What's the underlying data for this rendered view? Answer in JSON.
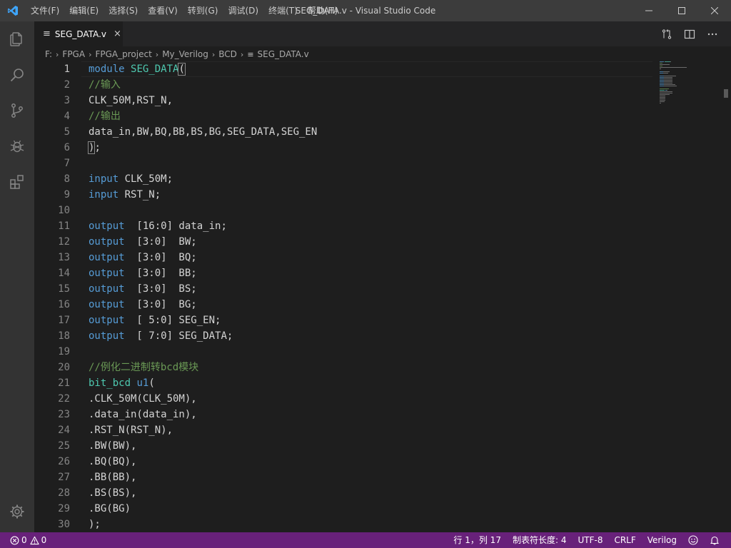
{
  "titlebar": {
    "menu": [
      "文件(F)",
      "编辑(E)",
      "选择(S)",
      "查看(V)",
      "转到(G)",
      "调试(D)",
      "终端(T)",
      "帮助(H)"
    ],
    "window_title": "SEG_DATA.v - Visual Studio Code"
  },
  "tab": {
    "label": "SEG_DATA.v",
    "close": "×"
  },
  "breadcrumb": [
    "F:",
    "FPGA",
    "FPGA_project",
    "My_Verilog",
    "BCD",
    "SEG_DATA.v"
  ],
  "code_lines": [
    {
      "n": "1",
      "parts": [
        {
          "t": "module",
          "c": "kw"
        },
        {
          "t": " "
        },
        {
          "t": "SEG_DATA",
          "c": "ident"
        },
        {
          "t": "(",
          "c": "bracket"
        }
      ]
    },
    {
      "n": "2",
      "parts": [
        {
          "t": "//输入",
          "c": "cm"
        }
      ]
    },
    {
      "n": "3",
      "parts": [
        {
          "t": "CLK_50M,RST_N,"
        }
      ]
    },
    {
      "n": "4",
      "parts": [
        {
          "t": "//输出",
          "c": "cm"
        }
      ]
    },
    {
      "n": "5",
      "parts": [
        {
          "t": "data_in,BW,BQ,BB,BS,BG,SEG_DATA,SEG_EN"
        }
      ]
    },
    {
      "n": "6",
      "parts": [
        {
          "t": ")",
          "c": "bracket"
        },
        {
          "t": ";"
        }
      ]
    },
    {
      "n": "7",
      "parts": []
    },
    {
      "n": "8",
      "parts": [
        {
          "t": "input",
          "c": "kw"
        },
        {
          "t": " CLK_50M;"
        }
      ]
    },
    {
      "n": "9",
      "parts": [
        {
          "t": "input",
          "c": "kw"
        },
        {
          "t": " RST_N;"
        }
      ]
    },
    {
      "n": "10",
      "parts": []
    },
    {
      "n": "11",
      "parts": [
        {
          "t": "output",
          "c": "kw"
        },
        {
          "t": "  [16:0] data_in;"
        }
      ]
    },
    {
      "n": "12",
      "parts": [
        {
          "t": "output",
          "c": "kw"
        },
        {
          "t": "  [3:0]  BW;"
        }
      ]
    },
    {
      "n": "13",
      "parts": [
        {
          "t": "output",
          "c": "kw"
        },
        {
          "t": "  [3:0]  BQ;"
        }
      ]
    },
    {
      "n": "14",
      "parts": [
        {
          "t": "output",
          "c": "kw"
        },
        {
          "t": "  [3:0]  BB;"
        }
      ]
    },
    {
      "n": "15",
      "parts": [
        {
          "t": "output",
          "c": "kw"
        },
        {
          "t": "  [3:0]  BS;"
        }
      ]
    },
    {
      "n": "16",
      "parts": [
        {
          "t": "output",
          "c": "kw"
        },
        {
          "t": "  [3:0]  BG;"
        }
      ]
    },
    {
      "n": "17",
      "parts": [
        {
          "t": "output",
          "c": "kw"
        },
        {
          "t": "  [ 5:0] SEG_EN;"
        }
      ]
    },
    {
      "n": "18",
      "parts": [
        {
          "t": "output",
          "c": "kw"
        },
        {
          "t": "  [ 7:0] SEG_DATA;"
        }
      ]
    },
    {
      "n": "19",
      "parts": []
    },
    {
      "n": "20",
      "parts": [
        {
          "t": "//例化二进制转bcd模块",
          "c": "cm"
        }
      ]
    },
    {
      "n": "21",
      "parts": [
        {
          "t": "bit_bcd",
          "c": "ident"
        },
        {
          "t": " "
        },
        {
          "t": "u1",
          "c": "kw"
        },
        {
          "t": "("
        }
      ]
    },
    {
      "n": "22",
      "parts": [
        {
          "t": ".CLK_50M(CLK_50M),"
        }
      ]
    },
    {
      "n": "23",
      "parts": [
        {
          "t": ".data_in(data_in),"
        }
      ]
    },
    {
      "n": "24",
      "parts": [
        {
          "t": ".RST_N(RST_N),"
        }
      ]
    },
    {
      "n": "25",
      "parts": [
        {
          "t": ".BW(BW),"
        }
      ]
    },
    {
      "n": "26",
      "parts": [
        {
          "t": ".BQ(BQ),"
        }
      ]
    },
    {
      "n": "27",
      "parts": [
        {
          "t": ".BB(BB),"
        }
      ]
    },
    {
      "n": "28",
      "parts": [
        {
          "t": ".BS(BS),"
        }
      ]
    },
    {
      "n": "29",
      "parts": [
        {
          "t": ".BG(BG)"
        }
      ]
    },
    {
      "n": "30",
      "parts": [
        {
          "t": ");"
        }
      ]
    }
  ],
  "active_line": "1",
  "statusbar": {
    "errors": "0",
    "warnings": "0",
    "cursor": "行 1，列 17",
    "tab_size": "制表符长度: 4",
    "encoding": "UTF-8",
    "eol": "CRLF",
    "language": "Verilog"
  },
  "colors": {
    "keyword": "#569cd6",
    "identifier": "#4ec9b0",
    "comment": "#6a9955",
    "text": "#d4d4d4",
    "statusbar": "#68217a"
  },
  "icons": {
    "app": "vscode-logo-icon",
    "activity": [
      "files-icon",
      "search-icon",
      "source-control-icon",
      "debug-icon",
      "extensions-icon",
      "settings-gear-icon"
    ],
    "editor_actions": [
      "open-changes-icon",
      "split-editor-icon",
      "more-actions-icon"
    ],
    "status": [
      "error-icon",
      "warning-icon",
      "feedback-smiley-icon",
      "notifications-bell-icon"
    ]
  }
}
